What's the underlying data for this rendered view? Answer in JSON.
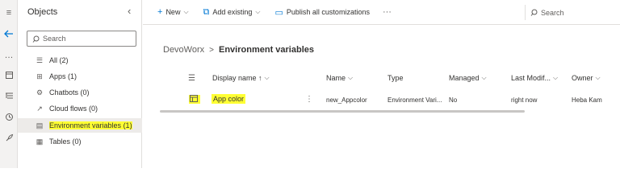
{
  "panel": {
    "title": "Objects",
    "search_placeholder": "Search",
    "items": [
      {
        "label": "All",
        "count": "(2)",
        "icon": "list-icon"
      },
      {
        "label": "Apps",
        "count": "(1)",
        "icon": "apps-icon"
      },
      {
        "label": "Chatbots",
        "count": "(0)",
        "icon": "chatbot-icon"
      },
      {
        "label": "Cloud flows",
        "count": "(0)",
        "icon": "flow-icon"
      },
      {
        "label": "Environment variables",
        "count": "(1)",
        "icon": "environment-variable-icon"
      },
      {
        "label": "Tables",
        "count": "(0)",
        "icon": "table-icon"
      }
    ]
  },
  "command_bar": {
    "new_label": "New",
    "add_existing_label": "Add existing",
    "publish_label": "Publish all customizations",
    "more_label": "···",
    "search_label": "Search"
  },
  "breadcrumb": {
    "parent": "DevoWorx",
    "separator": ">",
    "current": "Environment variables"
  },
  "table": {
    "headers": {
      "display_name": "Display name ↑",
      "name": "Name",
      "type": "Type",
      "managed": "Managed",
      "last_modified": "Last Modif...",
      "owner": "Owner"
    },
    "rows": [
      {
        "display_name": "App color",
        "more": "⋮",
        "name": "new_Appcolor",
        "type": "Environment Vari...",
        "managed": "No",
        "last_modified": "right now",
        "owner": "Heba Kam"
      }
    ]
  },
  "colors": {
    "highlight": "#ffff33",
    "accent": "#0078d4"
  }
}
